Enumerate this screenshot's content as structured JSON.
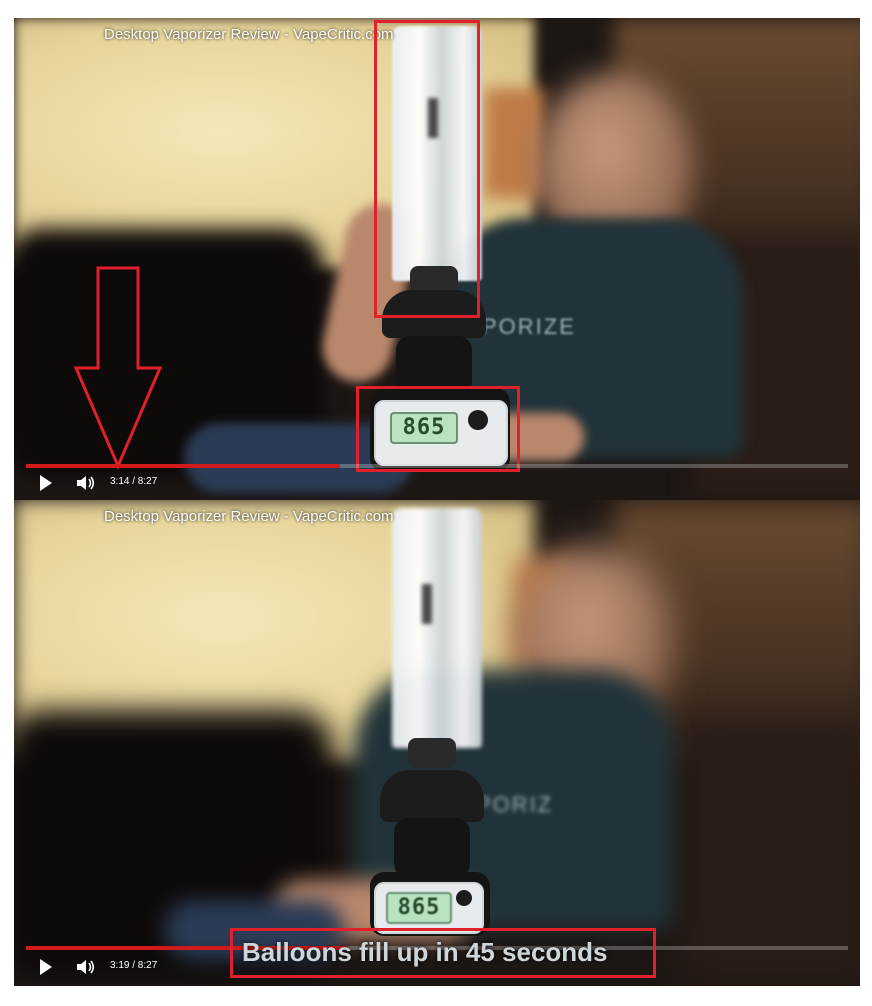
{
  "top_frame": {
    "video_title": "Desktop Vaporizer Review - VapeCritic.com",
    "device_display": "865",
    "shirt_text": "PORIZE",
    "player": {
      "current_time": "3:14",
      "duration": "8:27",
      "time_label": "3:14 / 8:27",
      "progress": 0.382
    }
  },
  "bottom_frame": {
    "video_title": "Desktop Vaporizer Review - VapeCritic.com",
    "device_display": "865",
    "shirt_text": "PORIZ",
    "player": {
      "current_time": "3:19",
      "duration": "8:27",
      "time_label": "3:19 / 8:27",
      "progress": 0.392
    },
    "caption": "Balloons fill up in 45 seconds"
  },
  "colors": {
    "annotation_red": "#e0202a",
    "progress_red": "#d11a1a"
  },
  "icons": [
    "play-icon",
    "volume-icon",
    "down-arrow-annotation-icon"
  ]
}
